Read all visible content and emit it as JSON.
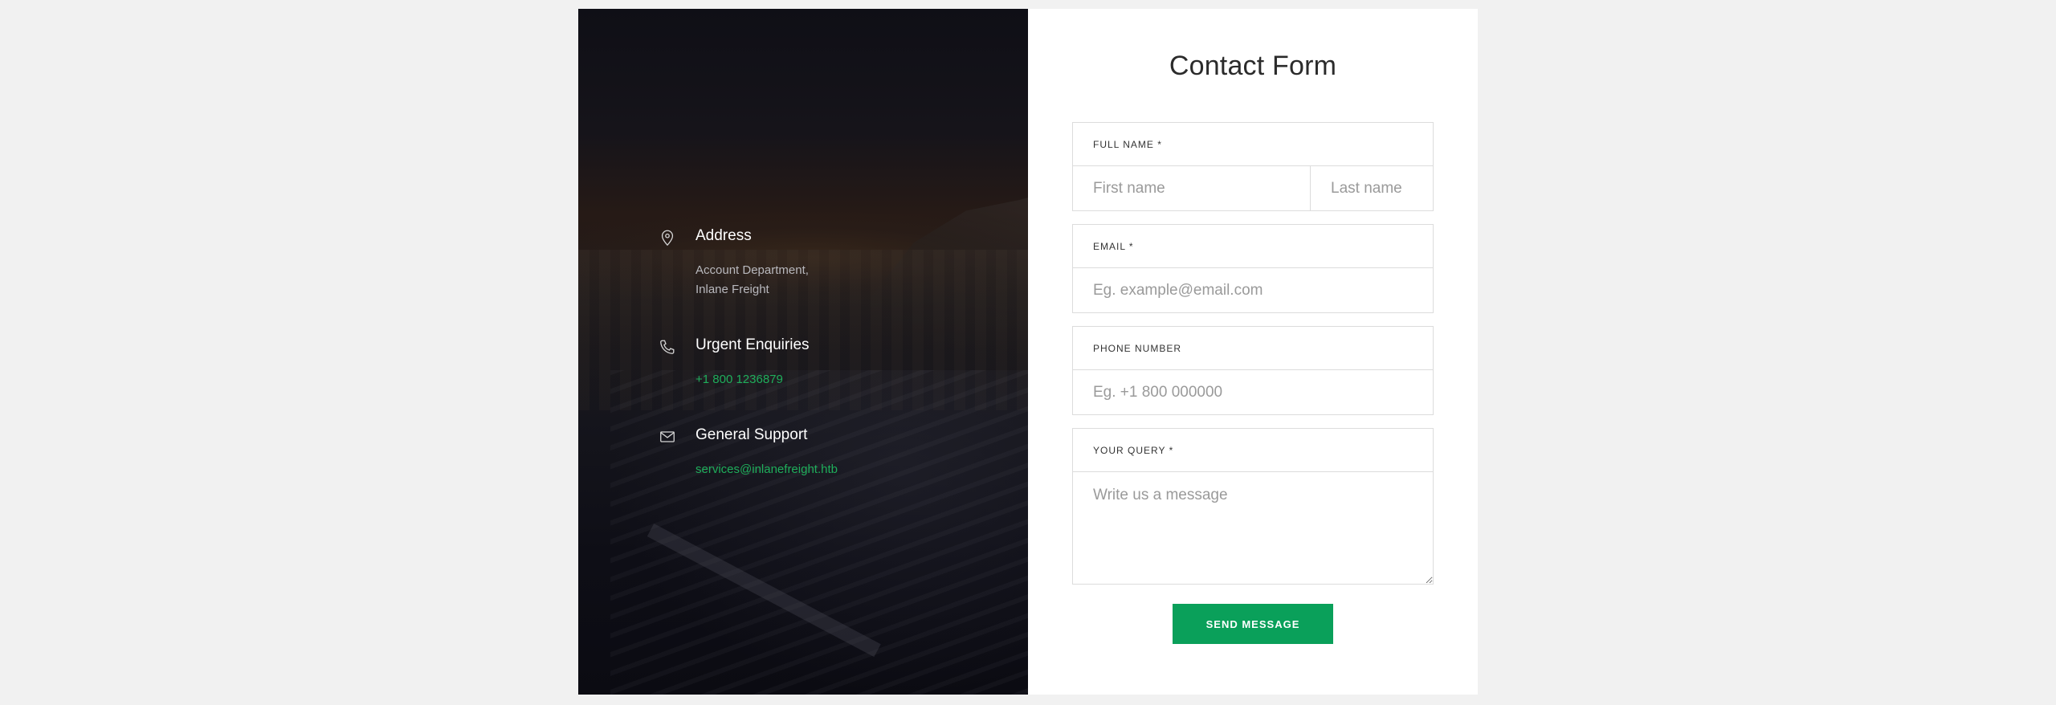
{
  "contact_info": {
    "address": {
      "icon": "map-pin-icon",
      "title": "Address",
      "lines": [
        "Account Department,",
        "Inlane Freight"
      ]
    },
    "urgent": {
      "icon": "phone-icon",
      "title": "Urgent Enquiries",
      "phone": "+1 800 1236879"
    },
    "support": {
      "icon": "envelope-icon",
      "title": "General Support",
      "email": "services@inlanefreight.htb"
    },
    "link_color": "#1fae5b"
  },
  "form": {
    "title": "Contact Form",
    "full_name": {
      "label": "FULL NAME *",
      "first_placeholder": "First name",
      "last_placeholder": "Last name",
      "first_value": "",
      "last_value": ""
    },
    "email": {
      "label": "EMAIL *",
      "placeholder": "Eg. example@email.com",
      "value": ""
    },
    "phone": {
      "label": "PHONE NUMBER",
      "placeholder": "Eg. +1 800 000000",
      "value": ""
    },
    "query": {
      "label": "YOUR QUERY *",
      "placeholder": "Write us a message",
      "value": ""
    },
    "submit_label": "SEND MESSAGE",
    "submit_color": "#0aa05a"
  }
}
